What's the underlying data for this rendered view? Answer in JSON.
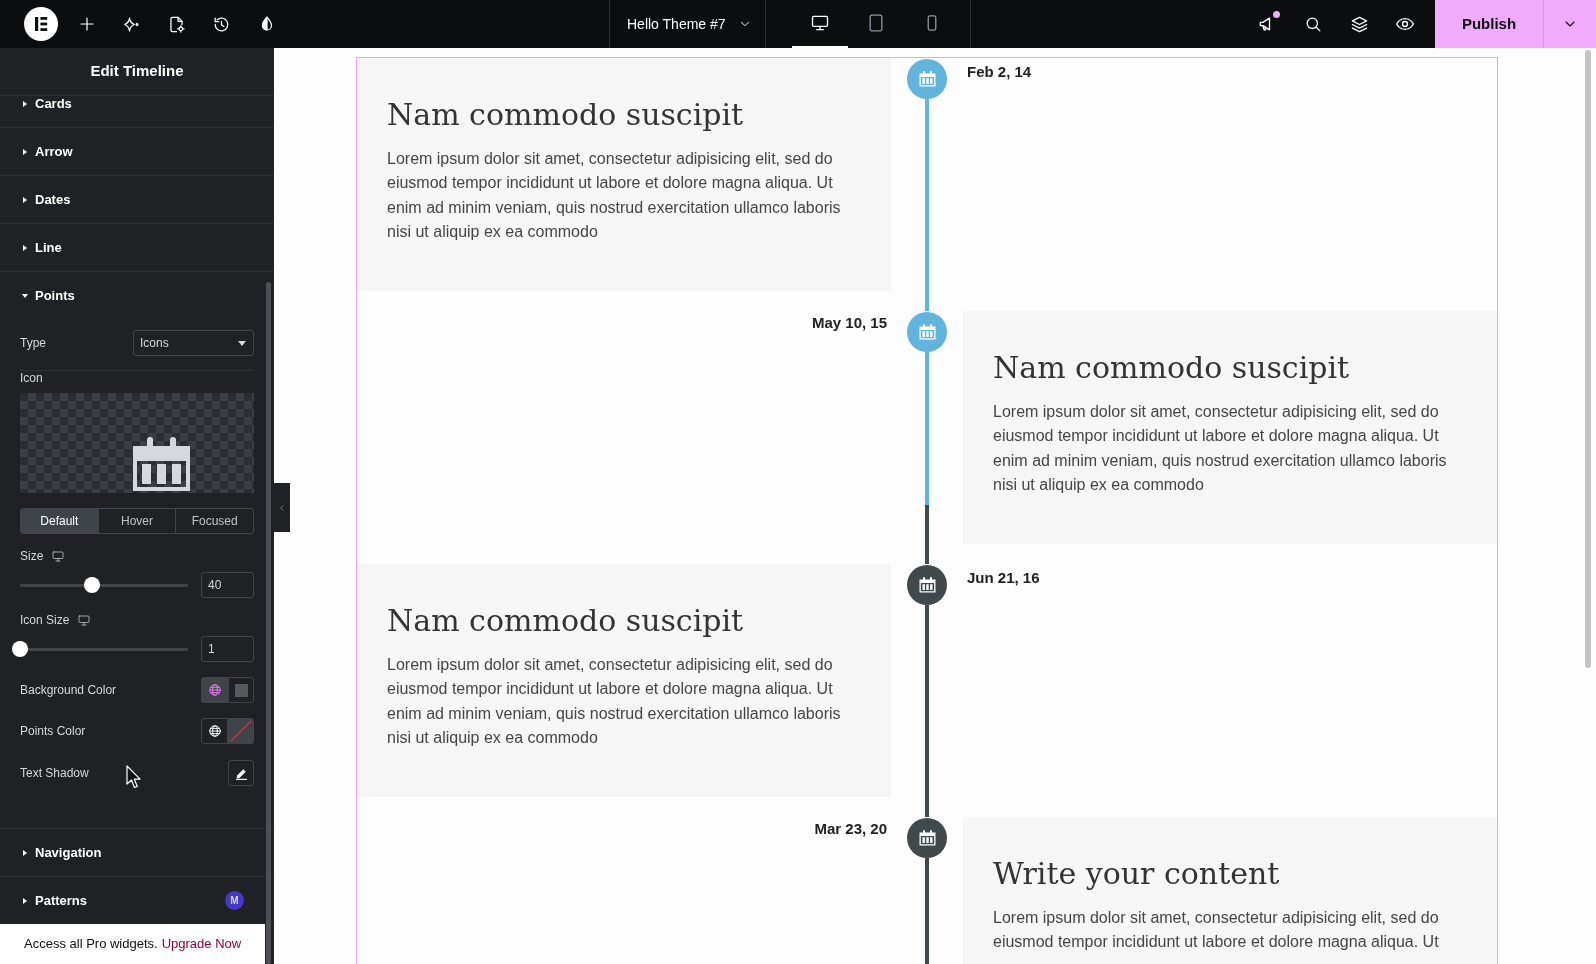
{
  "top_bar": {
    "document_title": "Hello Theme #7",
    "devices": [
      {
        "kind": "desktop",
        "selected": true
      },
      {
        "kind": "tablet",
        "selected": false
      },
      {
        "kind": "mobile",
        "selected": false
      }
    ],
    "notifications": {
      "unread": true
    },
    "publish": "Publish"
  },
  "panel": {
    "title": "Edit Timeline",
    "sections": [
      {
        "label": "Cards",
        "expanded": false
      },
      {
        "label": "Arrow",
        "expanded": false
      },
      {
        "label": "Dates",
        "expanded": false
      },
      {
        "label": "Line",
        "expanded": false
      },
      {
        "label": "Points",
        "expanded": true,
        "controls": [
          {
            "kind": "select",
            "label": "Type",
            "value": "Icons"
          },
          {
            "kind": "icon_picker",
            "label": "Icon"
          },
          {
            "kind": "state_tabs",
            "tabs": [
              {
                "label": "Default",
                "selected": true
              },
              {
                "label": "Hover",
                "selected": false
              },
              {
                "label": "Focused",
                "selected": false
              }
            ]
          },
          {
            "kind": "slider",
            "label": "Size",
            "responsive": true,
            "level": 0.43,
            "value": "40"
          },
          {
            "kind": "slider",
            "label": "Icon Size",
            "responsive": true,
            "level": 0,
            "value": "1"
          },
          {
            "kind": "color",
            "label": "Background Color",
            "global": true,
            "color": "#55585d"
          },
          {
            "kind": "color",
            "label": "Points Color",
            "global": false
          },
          {
            "kind": "popover",
            "label": "Text Shadow"
          }
        ]
      },
      {
        "label": "Navigation",
        "expanded": false
      },
      {
        "label": "Patterns",
        "expanded": false,
        "badge": "M"
      }
    ],
    "promo": {
      "text": "Access all Pro widgets.",
      "link": "Upgrade Now"
    }
  },
  "timeline": {
    "items": [
      {
        "date": "Feb 2, 14",
        "title": "Nam commodo suscipit",
        "text": "Lorem ipsum dolor sit amet, consectetur adipisicing elit, sed do eiusmod tempor incididunt ut labore et dolore magna aliqua. Ut enim ad minim veniam, quis nostrud exercitation ullamco laboris nisi ut aliquip ex ea commodo",
        "active": true
      },
      {
        "date": "May 10, 15",
        "title": "Nam commodo suscipit",
        "text": "Lorem ipsum dolor sit amet, consectetur adipisicing elit, sed do eiusmod tempor incididunt ut labore et dolore magna aliqua. Ut enim ad minim veniam, quis nostrud exercitation ullamco laboris nisi ut aliquip ex ea commodo",
        "active": true,
        "level": 0.72
      },
      {
        "date": "Jun 21, 16",
        "title": "Nam commodo suscipit",
        "text": "Lorem ipsum dolor sit amet, consectetur adipisicing elit, sed do eiusmod tempor incididunt ut labore et dolore magna aliqua. Ut enim ad minim veniam, quis nostrud exercitation ullamco laboris nisi ut aliquip ex ea commodo",
        "active": false
      },
      {
        "date": "Mar 23, 20",
        "title": "Write your content",
        "text": "Lorem ipsum dolor sit amet, consectetur adipisicing elit, sed do eiusmod tempor incididunt ut labore et dolore magna aliqua. Ut",
        "active": false
      }
    ]
  }
}
